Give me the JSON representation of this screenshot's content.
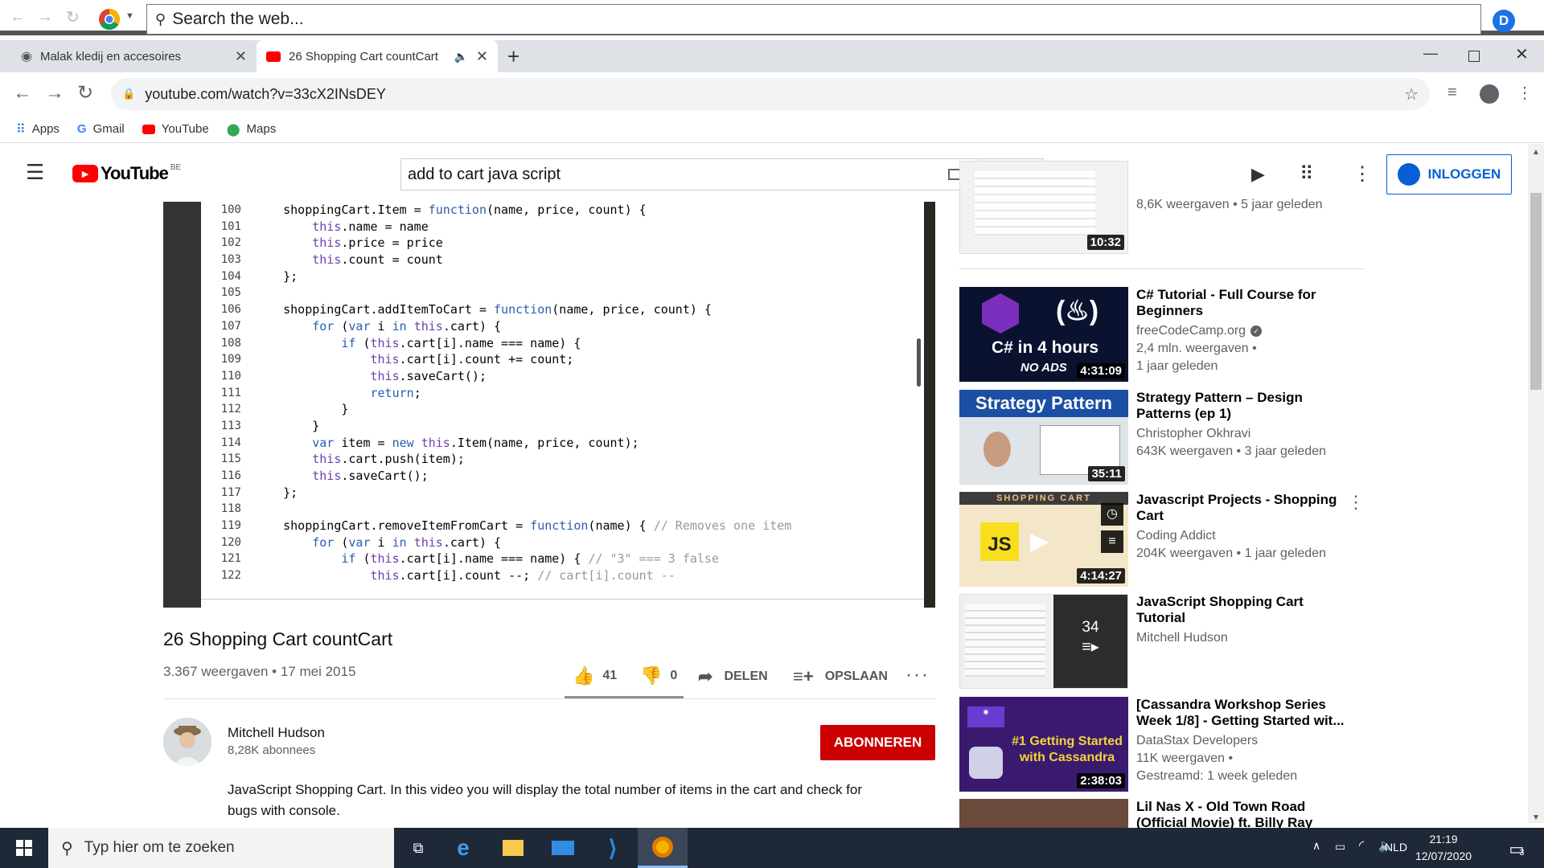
{
  "wrapper": {
    "search_placeholder": "Search the web..."
  },
  "tabs": [
    {
      "label": "Malak kledij en accesoires"
    },
    {
      "label": "26 Shopping Cart countCart"
    }
  ],
  "address": {
    "url": "youtube.com/watch?v=33cX2INsDEY"
  },
  "bookmarks": [
    {
      "label": "Apps"
    },
    {
      "label": "Gmail"
    },
    {
      "label": "YouTube"
    },
    {
      "label": "Maps"
    }
  ],
  "masthead": {
    "logo_text": "YouTube",
    "region": "BE",
    "search_value": "add to cart java script",
    "login_label": "INLOGGEN"
  },
  "code": {
    "line_numbers": [
      "100",
      "101",
      "102",
      "103",
      "104",
      "105",
      "106",
      "107",
      "108",
      "109",
      "110",
      "111",
      "112",
      "113",
      "114",
      "115",
      "116",
      "117",
      "118",
      "119",
      "120",
      "121",
      "122"
    ],
    "lines": [
      "    shoppingCart.Item = function(name, price, count) {",
      "        this.name = name",
      "        this.price = price",
      "        this.count = count",
      "    };",
      "",
      "    shoppingCart.addItemToCart = function(name, price, count) {",
      "        for (var i in this.cart) {",
      "            if (this.cart[i].name === name) {",
      "                this.cart[i].count += count;",
      "                this.saveCart();",
      "                return;",
      "            }",
      "        }",
      "        var item = new this.Item(name, price, count);",
      "        this.cart.push(item);",
      "        this.saveCart();",
      "    };",
      "",
      "    shoppingCart.removeItemFromCart = function(name) { // Removes one item",
      "        for (var i in this.cart) {",
      "            if (this.cart[i].name === name) { // \"3\" === 3 false",
      "                this.cart[i].count --; // cart[i].count --"
    ]
  },
  "video": {
    "title": "26 Shopping Cart countCart",
    "meta": "3.367 weergaven • 17 mei 2015",
    "likes": "41",
    "dislikes": "0",
    "share_label": "DELEN",
    "save_label": "OPSLAAN"
  },
  "channel": {
    "name": "Mitchell Hudson",
    "subs": "8,28K abonnees",
    "subscribe_label": "ABONNEREN"
  },
  "description": "JavaScript Shopping Cart. In this video you will display the total number of items in the cart and check for bugs with console.",
  "top_rec_meta": "8,6K weergaven • 5 jaar geleden",
  "top_rec_duration": "10:32",
  "recommendations": [
    {
      "title": "C# Tutorial - Full Course for Beginners",
      "channel": "freeCodeCamp.org",
      "meta": [
        "2,4 mln. weergaven •",
        "1 jaar geleden"
      ],
      "duration": "4:31:09",
      "thumb_text": "C# in 4 hours",
      "thumb_sub": "NO ADS"
    },
    {
      "title": "Strategy Pattern – Design Patterns (ep 1)",
      "channel": "Christopher Okhravi",
      "meta": [
        "643K weergaven • 3 jaar geleden"
      ],
      "duration": "35:11",
      "thumb_text": "Strategy Pattern"
    },
    {
      "title": "Javascript Projects - Shopping Cart",
      "channel": "Coding Addict",
      "meta": [
        "204K weergaven • 1 jaar geleden"
      ],
      "duration": "4:14:27",
      "thumb_text": "SHOPPING CART",
      "thumb_sub": "JS"
    },
    {
      "title": "JavaScript Shopping Cart Tutorial",
      "channel": "Mitchell Hudson",
      "meta": [],
      "playlist_count": "34"
    },
    {
      "title": "[Cassandra Workshop Series Week 1/8] - Getting Started wit...",
      "channel": "DataStax Developers",
      "meta": [
        "11K weergaven •",
        "Gestreamd: 1 week geleden"
      ],
      "duration": "2:38:03",
      "thumb_text": "#1 Getting Started with Cassandra"
    },
    {
      "title": "Lil Nas X - Old Town Road (Official Movie) ft. Billy Ray",
      "channel": "",
      "meta": []
    }
  ],
  "taskbar": {
    "search_placeholder": "Typ hier om te zoeken",
    "lang": "NLD",
    "time": "21:19",
    "date": "12/07/2020",
    "notifications": "3"
  },
  "colors": {
    "yt_red": "#ff0000",
    "subscribe_red": "#cc0000",
    "link_blue": "#065fd4",
    "taskbar": "#1f2836"
  }
}
